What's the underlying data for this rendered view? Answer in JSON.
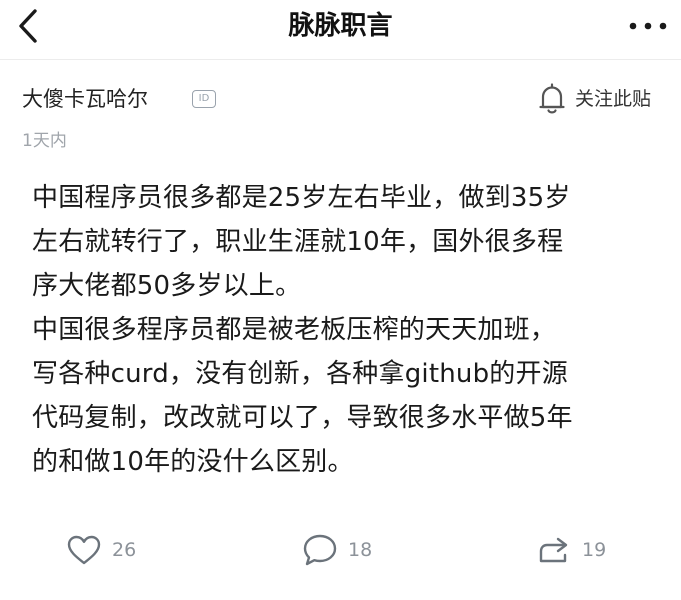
{
  "header": {
    "title": "脉脉职言"
  },
  "author": {
    "name": "大傻卡瓦哈尔",
    "badge": "ID",
    "follow_label": "关注此贴"
  },
  "post": {
    "time": "1天内",
    "content": "中国程序员很多都是25岁左右毕业，做到35岁\n左右就转行了，职业生涯就10年，国外很多程\n序大佬都50多岁以上。\n中国很多程序员都是被老板压榨的天天加班，\n写各种curd，没有创新，各种拿github的开源\n代码复制，改改就可以了，导致很多水平做5年\n的和做10年的没什么区别。"
  },
  "actions": {
    "likes": "26",
    "comments": "18",
    "reposts": "19"
  },
  "icons": {
    "back": "back-arrow-icon",
    "more": "more-dots-icon",
    "bell": "bell-icon",
    "like": "heart-icon",
    "comment": "comment-bubble-icon",
    "repost": "share-arrow-icon"
  },
  "colors": {
    "text": "#1a1a1a",
    "muted": "#a0a5ab",
    "icon": "#6b737b"
  }
}
